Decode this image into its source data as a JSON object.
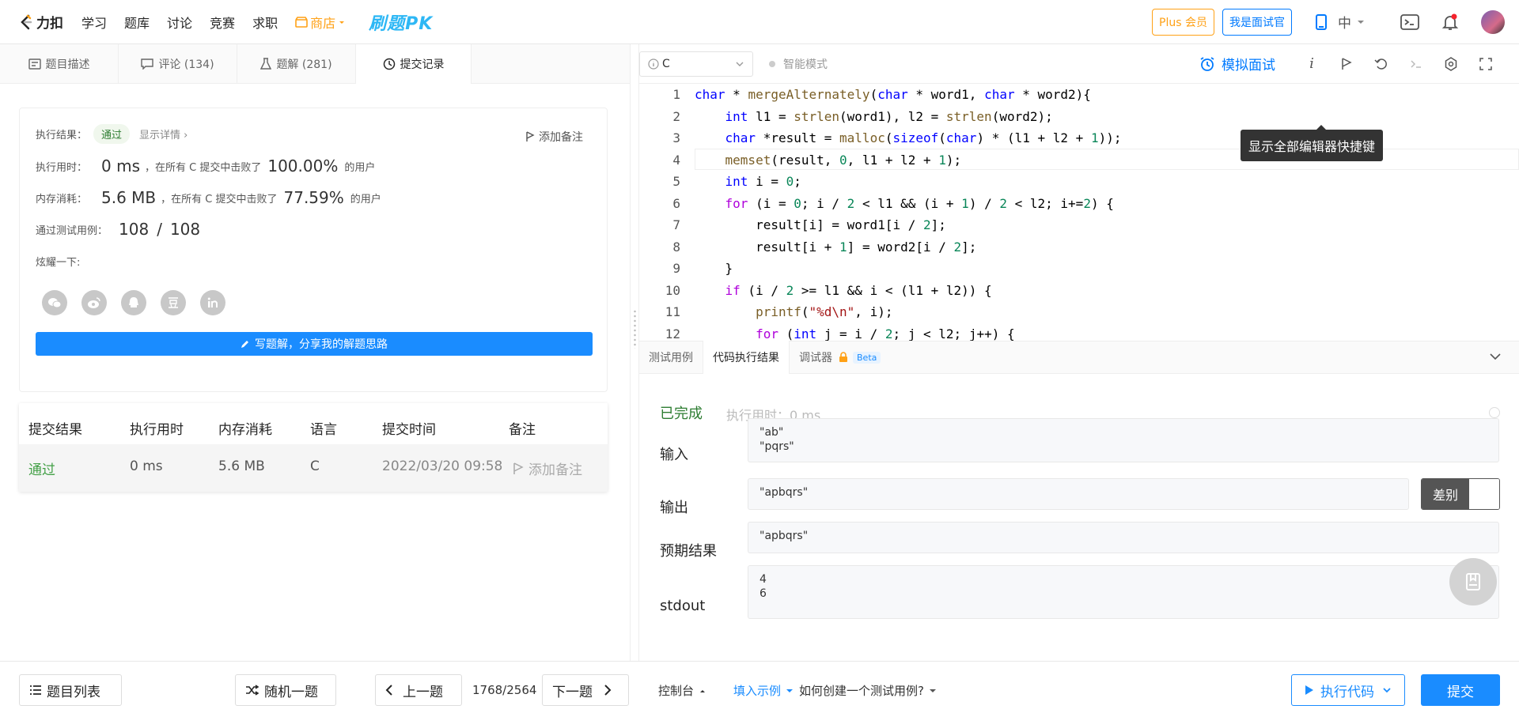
{
  "nav": {
    "logo_text": "力扣",
    "items": [
      "学习",
      "题库",
      "讨论",
      "竞赛",
      "求职"
    ],
    "shop": "商店",
    "pk": "刷题PK",
    "plus": "Plus 会员",
    "interviewer": "我是面试官",
    "lang": "中"
  },
  "left": {
    "tabs": [
      {
        "label": "题目描述"
      },
      {
        "label": "评论 (134)"
      },
      {
        "label": "题解 (281)"
      },
      {
        "label": "提交记录"
      }
    ],
    "result": {
      "label_result": "执行结果：",
      "status": "通过",
      "detail": "显示详情 ›",
      "add_note": "添加备注",
      "label_time": "执行用时：",
      "time_value": "0 ms",
      "time_text": "，在所有 C 提交中击败了",
      "time_pct": "100.00%",
      "users": "的用户",
      "label_mem": "内存消耗：",
      "mem_value": "5.6 MB",
      "mem_text": "，在所有 C 提交中击败了",
      "mem_pct": "77.59%",
      "label_cases": "通过测试用例：",
      "cases_passed": "108",
      "cases_sep": "/",
      "cases_total": "108",
      "share_label": "炫耀一下:",
      "write_btn": "写题解，分享我的解题思路"
    },
    "table": {
      "headers": [
        "提交结果",
        "执行用时",
        "内存消耗",
        "语言",
        "提交时间",
        "备注"
      ],
      "row": {
        "status": "通过",
        "time": "0 ms",
        "mem": "5.6 MB",
        "lang": "C",
        "date": "2022/03/20 09:58",
        "note": "添加备注"
      }
    }
  },
  "right": {
    "language": "C",
    "smart_mode": "智能模式",
    "mock_interview": "模拟面试",
    "tooltip": "显示全部编辑器快捷键",
    "line_numbers": [
      "1",
      "2",
      "3",
      "4",
      "5",
      "6",
      "7",
      "8",
      "9",
      "10",
      "11",
      "12"
    ],
    "bottom_tabs": [
      "测试用例",
      "代码执行结果",
      "调试器"
    ],
    "beta": "Beta",
    "done": "已完成",
    "exec_time": "执行用时：0 ms",
    "input_label": "输入",
    "input_value": "\"ab\"\n\"pqrs\"",
    "output_label": "输出",
    "output_value": "\"apbqrs\"",
    "diff": "差别",
    "expected_label": "预期结果",
    "expected_value": "\"apbqrs\"",
    "stdout_label": "stdout",
    "stdout_value": "4\n6"
  },
  "footer": {
    "problem_list": "题目列表",
    "random": "随机一题",
    "prev": "上一题",
    "counter": "1768/2564",
    "next": "下一题",
    "console": "控制台",
    "fill_example": "填入示例",
    "how_to": "如何创建一个测试用例?",
    "run": "执行代码",
    "submit": "提交"
  },
  "colors": {
    "accent": "#1a8cff",
    "success": "#2e7d32",
    "shop": "#ffa116"
  }
}
